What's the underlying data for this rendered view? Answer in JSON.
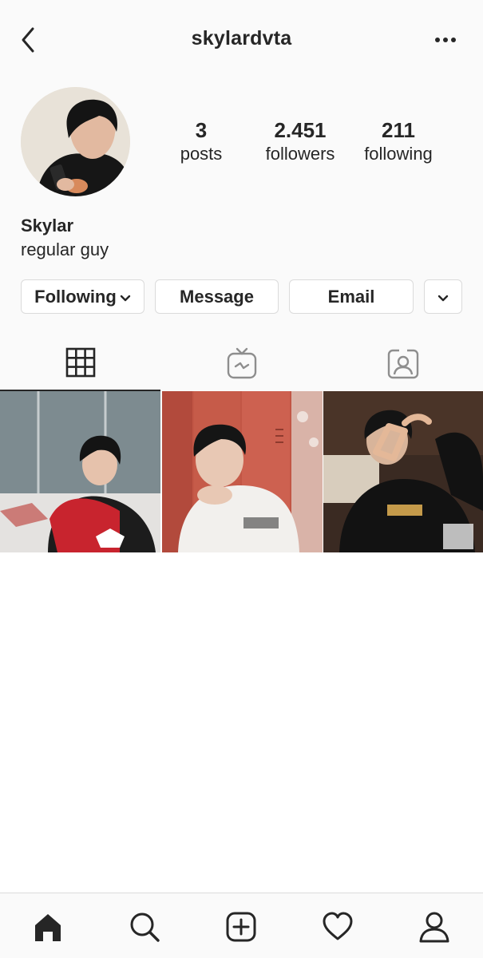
{
  "header": {
    "username": "skylardvta",
    "back_icon": "chevron-left-icon",
    "more_icon": "more-horizontal-icon"
  },
  "profile": {
    "name": "Skylar",
    "bio": "regular guy",
    "stats": {
      "posts": {
        "value": "3",
        "label": "posts"
      },
      "followers": {
        "value": "2.451",
        "label": "followers"
      },
      "following": {
        "value": "211",
        "label": "following"
      }
    }
  },
  "actions": {
    "following_label": "Following",
    "message_label": "Message",
    "email_label": "Email"
  },
  "tabs": [
    {
      "icon": "grid-icon",
      "active": true
    },
    {
      "icon": "igtv-icon",
      "active": false
    },
    {
      "icon": "tagged-icon",
      "active": false
    }
  ],
  "posts": [
    {
      "description": "person in red top waving at ice rink"
    },
    {
      "description": "person in white hoodie in front of lockers"
    },
    {
      "description": "person in black sweatshirt making frame with hands"
    }
  ],
  "bottom_nav": [
    "home-icon",
    "search-icon",
    "new-post-icon",
    "activity-heart-icon",
    "profile-icon"
  ],
  "colors": {
    "text": "#262626",
    "border": "#dbdbdb",
    "background": "#fafafa"
  }
}
